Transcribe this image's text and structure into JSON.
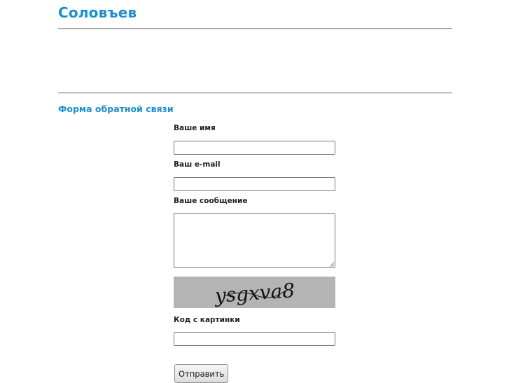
{
  "site": {
    "title": "Соловъев"
  },
  "feedback_form": {
    "title": "Форма обратной связи",
    "name_label": "Ваше имя",
    "name_value": "",
    "email_label": "Ваш e-mail",
    "email_value": "",
    "message_label": "Ваше сообщение",
    "message_value": "",
    "captcha_text": "ysgxva8",
    "captcha_label": "Код с картинки",
    "captcha_value": "",
    "submit_label": "Отправить"
  },
  "colors": {
    "accent": "#1d8ed0",
    "captcha_background": "#b4b4b4"
  }
}
